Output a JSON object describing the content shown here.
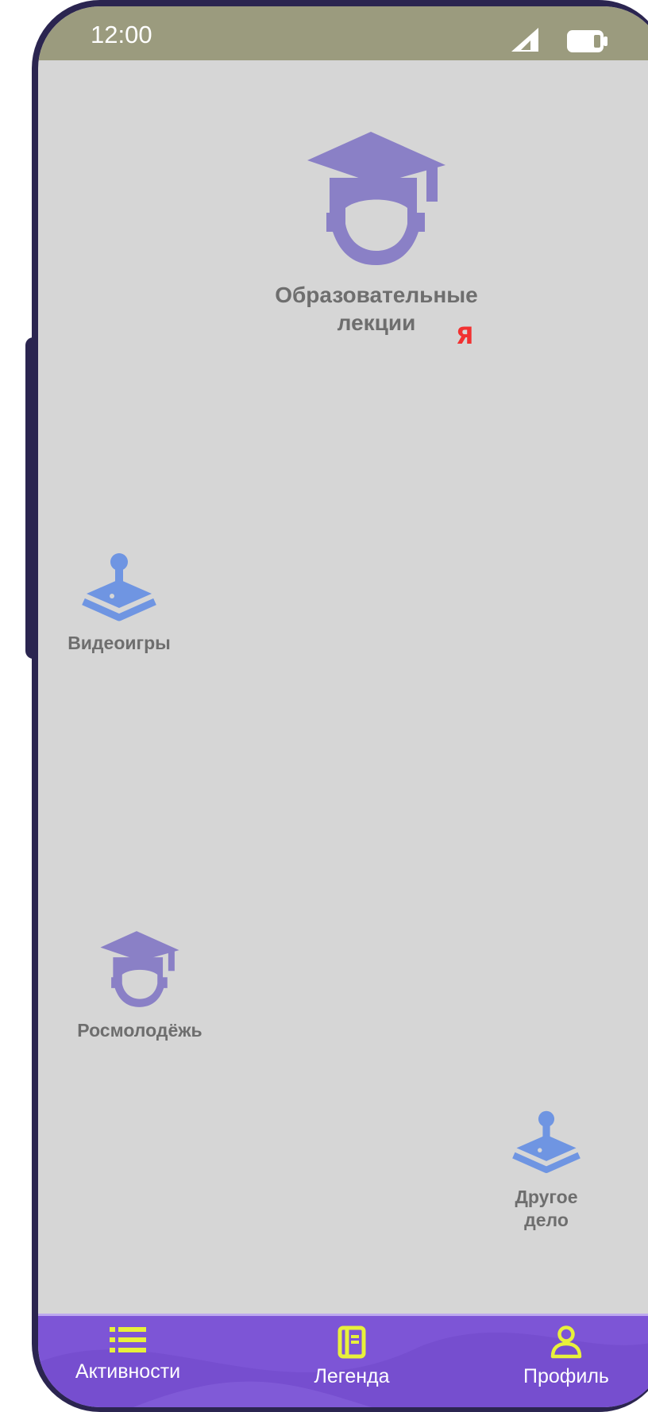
{
  "status_bar": {
    "time": "12:00"
  },
  "activities": {
    "lectures": {
      "label_line1": "Образовательные",
      "label_line2": "лекции"
    },
    "videogames": {
      "label": "Видеоигры"
    },
    "rosmol": {
      "label": "Росмолодёжь"
    },
    "other": {
      "label_line1": "Другое",
      "label_line2": "дело"
    }
  },
  "player_marker": {
    "label": "Я"
  },
  "bottom_nav": {
    "items": [
      {
        "label": "Активности",
        "icon": "list-icon"
      },
      {
        "label": "Легенда",
        "icon": "notebook-icon"
      },
      {
        "label": "Профиль",
        "icon": "user-icon"
      }
    ]
  },
  "colors": {
    "screen_bg": "#d6d6d6",
    "status_bar": "#9b9b7e",
    "phone_frame": "#2b2550",
    "nav_bg": "#7d55d6",
    "nav_icon": "#e8f03b",
    "graduation_icon": "#8a80c6",
    "joystick_icon": "#6f95e2",
    "label_text": "#6e6e6e",
    "marker": "#f23131"
  }
}
